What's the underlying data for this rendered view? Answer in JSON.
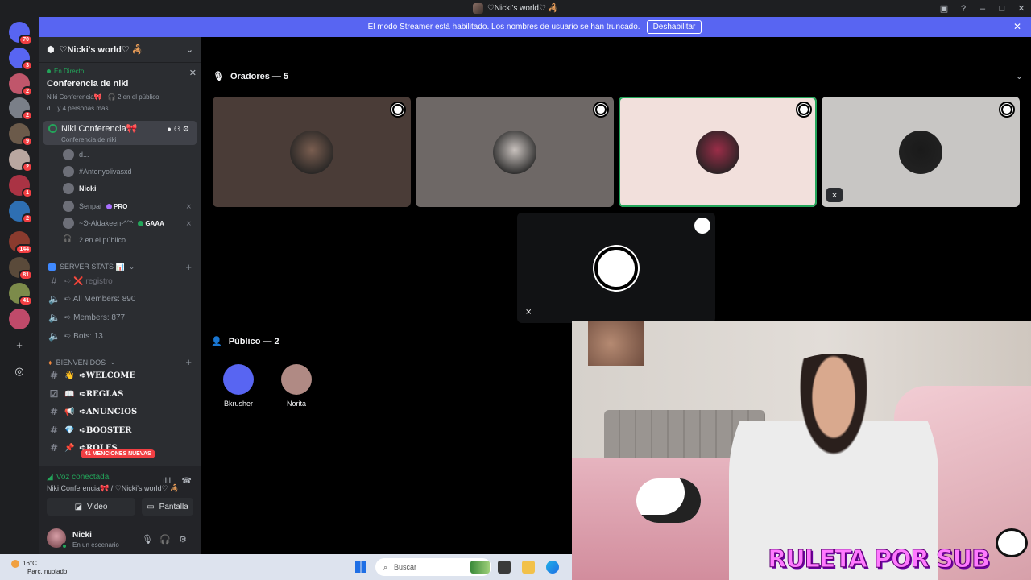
{
  "window": {
    "title": "♡Nicki's world♡ 🦂"
  },
  "banner": {
    "text": "El modo Streamer está habilitado. Los nombres de usuario se han truncado.",
    "button": "Deshabilitar"
  },
  "guilds": [
    {
      "badge": "70",
      "color": "#5865f2"
    },
    {
      "badge": "3",
      "color": "#5865f2"
    },
    {
      "badge": "2",
      "color": "#c0566b"
    },
    {
      "badge": "2",
      "color": "#7a7f88"
    },
    {
      "badge": "9",
      "color": "#6b5a4a"
    },
    {
      "badge": "2",
      "color": "#b9a7a0"
    },
    {
      "badge": "1",
      "color": "#aa3344"
    },
    {
      "badge": "2",
      "color": "#2e6fb2"
    },
    {
      "badge": "144",
      "color": "#8a3b2e"
    },
    {
      "badge": "81",
      "color": "#5a4a3a"
    },
    {
      "badge": "41",
      "color": "#7c8b4a"
    },
    {
      "badge": "",
      "color": "#c04a6a"
    }
  ],
  "server": {
    "name": "♡Nicki's world♡ 🦂"
  },
  "live": {
    "tag": "En Directo",
    "name": "Conferencia de niki",
    "sub": "Niki Conferencia🎀 · 🎧 2 en el público",
    "sub2": "d... y 4 personas más"
  },
  "active_channel": {
    "name": "Niki Conferencia🎀",
    "topic": "Conferencia de niki"
  },
  "members": [
    {
      "name": "d...",
      "bold": false,
      "tag": ""
    },
    {
      "name": "#Antonyolivasxd",
      "bold": false,
      "tag": ""
    },
    {
      "name": "Nicki",
      "bold": true,
      "tag": ""
    },
    {
      "name": "Senpai",
      "bold": false,
      "tag": "PRO"
    },
    {
      "name": "~Ͽ-Aldakeen-^°^",
      "bold": false,
      "tag": "GAAA"
    },
    {
      "name": "2 en el público",
      "bold": false,
      "tag": ""
    }
  ],
  "categories": {
    "stats": "SERVER STATS 📊",
    "welcome": "BIENVENIDOS"
  },
  "stat_channels": [
    {
      "name": "➪ ❌ registro"
    },
    {
      "name": "➪ All Members: 890"
    },
    {
      "name": "➪ Members: 877"
    },
    {
      "name": "➪ Bots: 13"
    }
  ],
  "text_channels": [
    {
      "emoji": "👋",
      "name": "➪WELCOME"
    },
    {
      "emoji": "📖",
      "name": "➪REGLAS"
    },
    {
      "emoji": "📢",
      "name": "➪ANUNCIOS"
    },
    {
      "emoji": "💎",
      "name": "➪BOOSTER"
    },
    {
      "emoji": "📌",
      "name": "➪ROLES"
    }
  ],
  "mentions": "41 MENCIONES NUEVAS",
  "voice": {
    "status": "Voz conectada",
    "location": "Niki Conferencia🎀 / ♡Nicki's world♡ 🦂",
    "video": "Video",
    "screen": "Pantalla"
  },
  "user": {
    "name": "Nicki",
    "status": "En un escenario"
  },
  "stage": {
    "speakers_header": "Oradores — 5",
    "audience_header": "Público — 2"
  },
  "speakers": [
    {
      "bg": "#4a3c37",
      "ring": "#7a5e50"
    },
    {
      "bg": "#6e6866",
      "ring": "#c9c2be"
    },
    {
      "bg": "#f2e0dc",
      "ring": "#9b2d48"
    },
    {
      "bg": "#c8c6c4",
      "ring": "#1a1a1a"
    }
  ],
  "audience": [
    {
      "name": "Bkrusher",
      "color": "#5865f2"
    },
    {
      "name": "Norita",
      "color": "#b08a84"
    }
  ],
  "overlay": {
    "logo": "RULETA POR SUB"
  },
  "taskbar": {
    "temp": "16°C",
    "weather": "Parc. nublado",
    "search": "Buscar"
  }
}
